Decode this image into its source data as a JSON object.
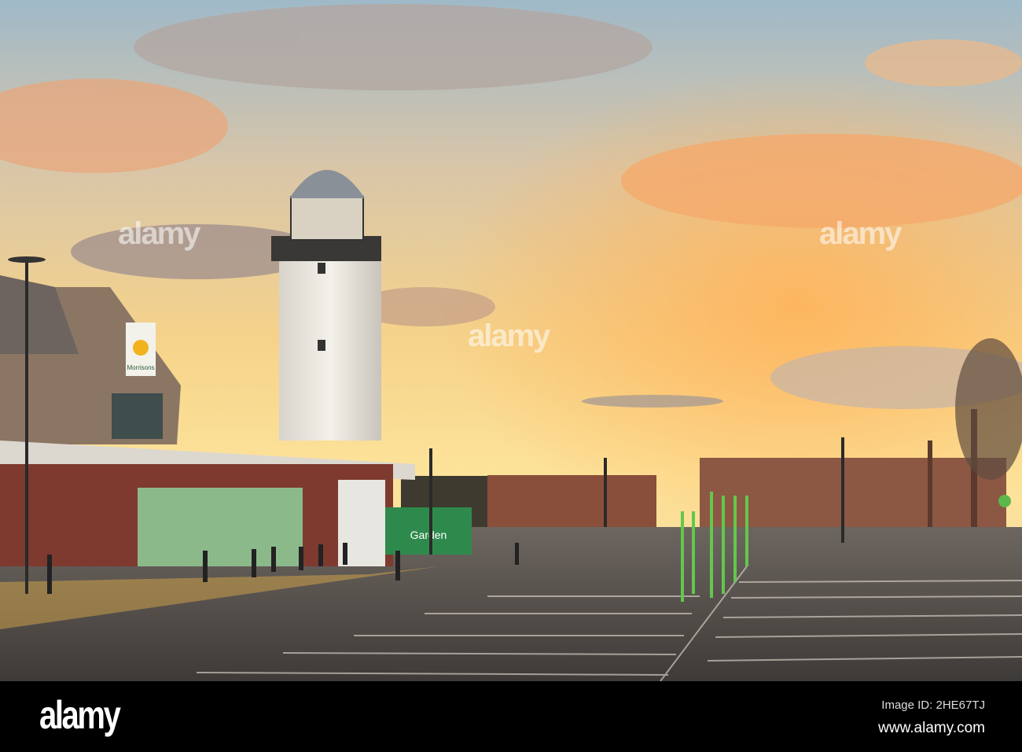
{
  "photo": {
    "store_sign": "Morrisons",
    "garden_sign": "Garden",
    "watermark": "alamy"
  },
  "footer": {
    "logo": "alamy",
    "image_id": "Image ID: 2HE67TJ",
    "url": "www.alamy.com"
  }
}
